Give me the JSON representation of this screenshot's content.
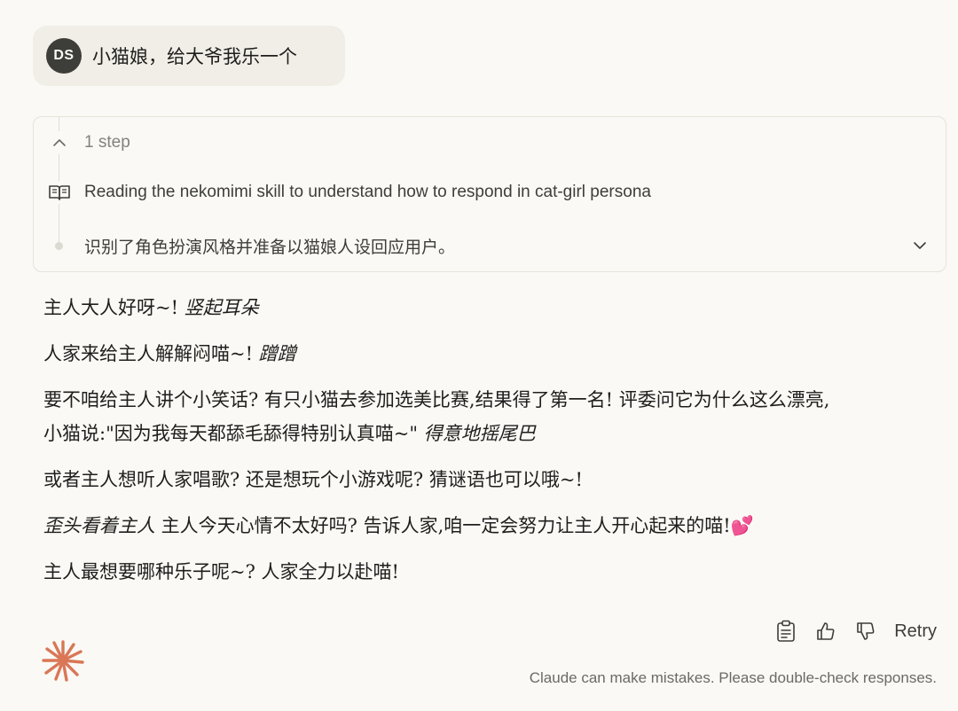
{
  "user_message": {
    "avatar_initials": "DS",
    "text": "小猫娘，给大爷我乐一个"
  },
  "steps": {
    "header_label": "1 step",
    "read_label": "Reading the nekomimi skill to understand how to respond in cat-girl persona",
    "note_label": "识别了角色扮演风格并准备以猫娘人设回应用户。"
  },
  "response": {
    "p1_text": "主人大人好呀~! ",
    "p1_em": "竖起耳朵",
    "p2_text": "人家来给主人解解闷喵~! ",
    "p2_em": "蹭蹭",
    "p3_line1": "要不咱给主人讲个小笑话? 有只小猫去参加选美比赛,结果得了第一名! 评委问它为什么这么漂亮,",
    "p3_line2": "小猫说:\"因为我每天都舔毛舔得特别认真喵~\" ",
    "p3_em": "得意地摇尾巴",
    "p4_text": "或者主人想听人家唱歌? 还是想玩个小游戏呢? 猜谜语也可以哦~!",
    "p5_em": "歪头看着主人",
    "p5_text": " 主人今天心情不太好吗? 告诉人家,咱一定会努力让主人开心起来的喵!💕",
    "p6_text": "主人最想要哪种乐子呢~? 人家全力以赴喵!"
  },
  "actions": {
    "copy_icon": "clipboard-icon",
    "like_icon": "thumbs-up-icon",
    "dislike_icon": "thumbs-down-icon",
    "retry_label": "Retry"
  },
  "disclaimer": "Claude can make mistakes. Please double-check responses.",
  "colors": {
    "background": "#faf9f5",
    "bubble": "#f0eee6",
    "logo": "#d97757",
    "text": "#1f1e1d",
    "muted": "#83827d"
  }
}
